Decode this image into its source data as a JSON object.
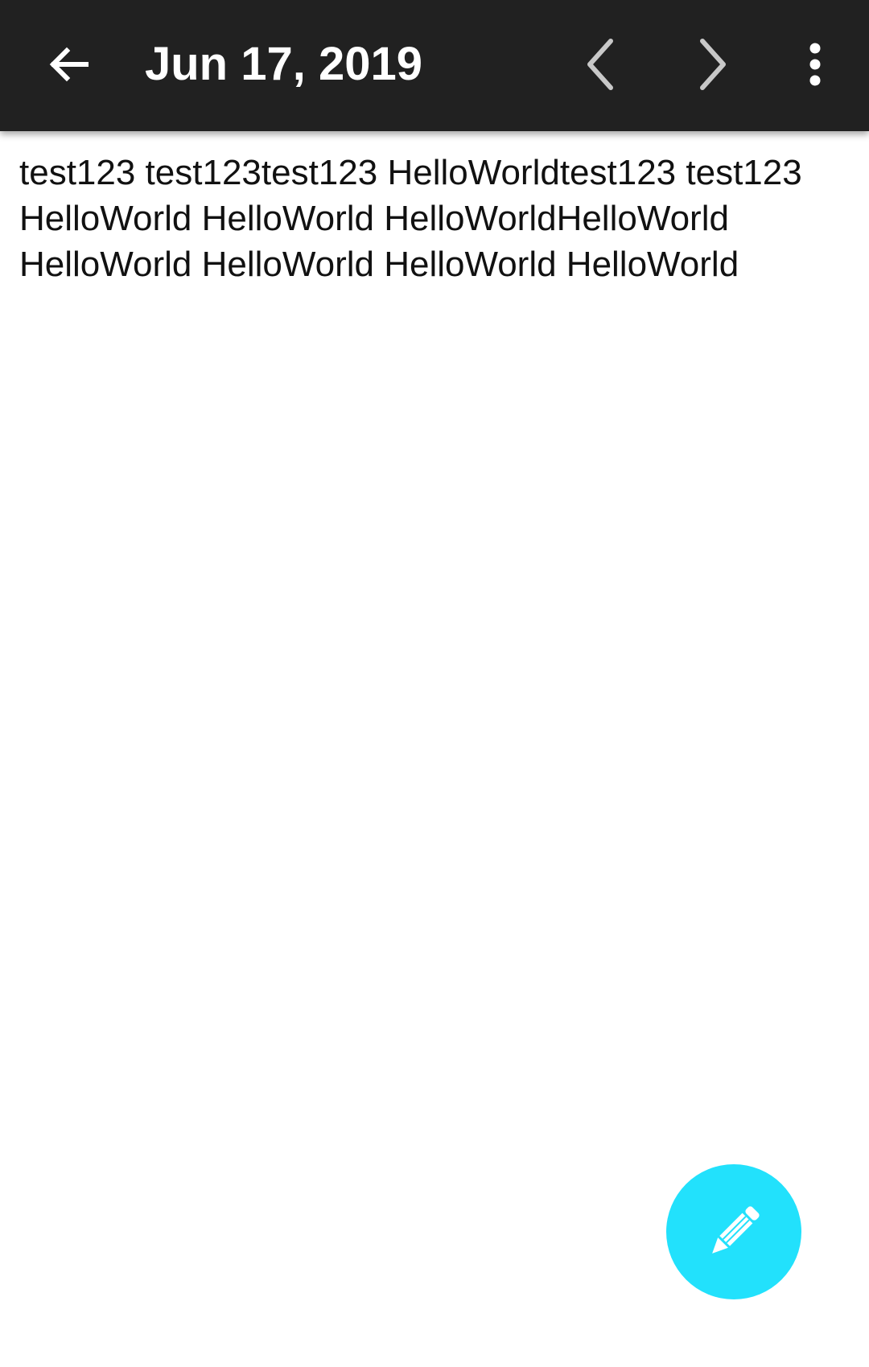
{
  "toolbar": {
    "title": "Jun 17, 2019",
    "background": "#212121",
    "icons": {
      "back": "arrow-back-icon",
      "previous": "chevron-left-icon",
      "next": "chevron-right-icon",
      "menu": "more-vertical-icon"
    }
  },
  "entry": {
    "text": "test123 test123test123 HelloWorldtest123 test123 HelloWorld HelloWorld HelloWorldHelloWorld HelloWorld HelloWorld HelloWorld HelloWorld"
  },
  "fab": {
    "icon": "pencil-icon",
    "color": "#22E1FC"
  }
}
